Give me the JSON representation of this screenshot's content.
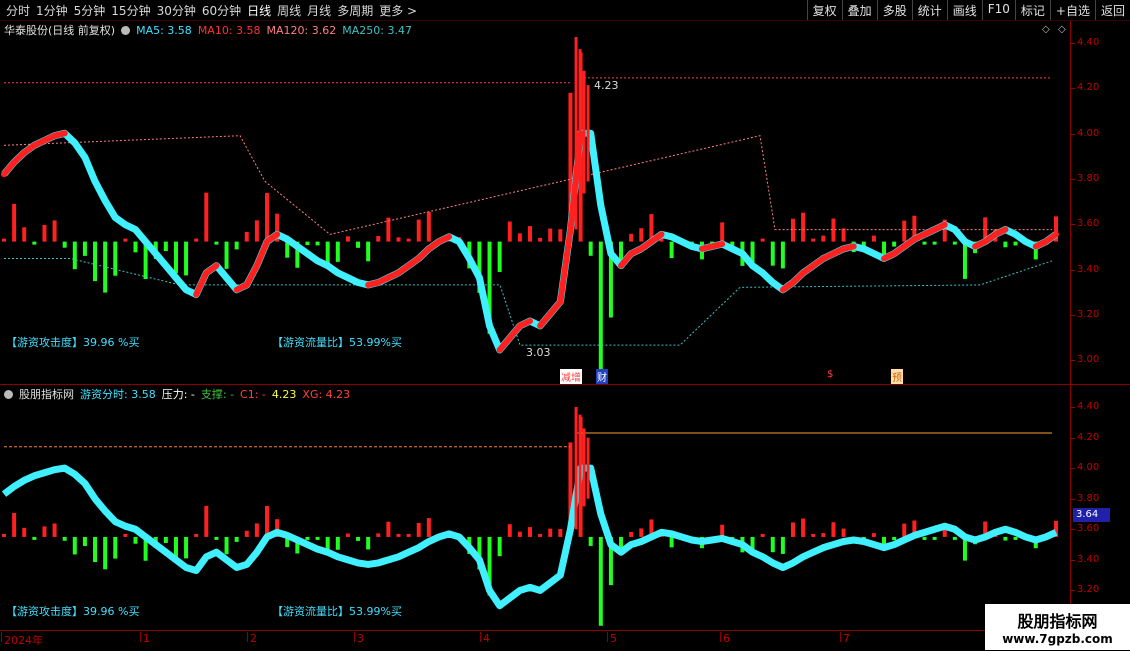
{
  "toolbar": {
    "periods": [
      "分时",
      "1分钟",
      "5分钟",
      "15分钟",
      "30分钟",
      "60分钟",
      "日线",
      "周线",
      "月线",
      "多周期",
      "更多 >"
    ],
    "active": "日线",
    "tools": [
      "复权",
      "叠加",
      "多股",
      "统计",
      "画线",
      "F10",
      "标记",
      "+自选",
      "返回"
    ]
  },
  "main": {
    "stock_title": "华泰股份(日线 前复权)",
    "ma": [
      {
        "label": "MA5: 3.58",
        "color": "#40e0ff"
      },
      {
        "label": "MA10: 3.58",
        "color": "#ff3030"
      },
      {
        "label": "MA120: 3.62",
        "color": "#ff8080"
      },
      {
        "label": "MA250: 3.47",
        "color": "#40c0c0"
      }
    ],
    "yticks": [
      "4.40",
      "4.20",
      "4.00",
      "3.80",
      "3.60",
      "3.40",
      "3.20",
      "3.00"
    ],
    "high_label": "4.23",
    "low_label": "3.03",
    "attack_label": "【游资攻击度】39.96 %买",
    "flow_label": "【游资流量比】53.99%买",
    "events": [
      {
        "text": "减增",
        "color": "#ff4040",
        "bg": "#ffffff"
      },
      {
        "text": "财",
        "color": "#ffffff",
        "bg": "#2040c0"
      },
      {
        "text": "$",
        "color": "#ff4040",
        "bg": "#000000"
      },
      {
        "text": "预",
        "color": "#d06020",
        "bg": "#ffe0a0"
      }
    ]
  },
  "sub": {
    "indicator_title": "股朋指标网",
    "items": [
      {
        "label": "游资分时: 3.58",
        "color": "#40e0ff"
      },
      {
        "label": "压力: -",
        "color": "#ffffff"
      },
      {
        "label": "支撑: -",
        "color": "#40c040"
      },
      {
        "label": "C1: -",
        "color": "#ff4040"
      },
      {
        "label": "4.23",
        "color": "#ffff40"
      },
      {
        "label": "XG: 4.23",
        "color": "#ff4040"
      }
    ],
    "yticks": [
      "4.40",
      "4.20",
      "4.00",
      "3.80",
      "3.60",
      "3.40",
      "3.20"
    ],
    "price_tag": "3.64",
    "attack_label": "【游资攻击度】39.96 %买",
    "flow_label": "【游资流量比】53.99%买"
  },
  "date_axis": [
    "2024年",
    "1",
    "2",
    "3",
    "4",
    "5",
    "6",
    "7"
  ],
  "watermark": {
    "line1": "股朋指标网",
    "line2": "www.7gpzb.com"
  },
  "chart_data": {
    "type": "line",
    "title": "华泰股份(日线 前复权)",
    "ylim": [
      3.0,
      4.4
    ],
    "series": [
      {
        "name": "MA5",
        "values": [
          3.83,
          3.88,
          3.92,
          3.95,
          3.97,
          3.99,
          4.0,
          3.96,
          3.9,
          3.8,
          3.72,
          3.65,
          3.62,
          3.6,
          3.55,
          3.5,
          3.45,
          3.4,
          3.35,
          3.33,
          3.42,
          3.45,
          3.4,
          3.35,
          3.37,
          3.45,
          3.55,
          3.58,
          3.56,
          3.53,
          3.5,
          3.47,
          3.45,
          3.42,
          3.4,
          3.38,
          3.37,
          3.38,
          3.4,
          3.42,
          3.45,
          3.48,
          3.52,
          3.55,
          3.57,
          3.55,
          3.48,
          3.4,
          3.2,
          3.1,
          3.15,
          3.2,
          3.22,
          3.2,
          3.25,
          3.3,
          3.6,
          4.0,
          4.0,
          3.7,
          3.5,
          3.45,
          3.5,
          3.52,
          3.55,
          3.58,
          3.57,
          3.55,
          3.53,
          3.52,
          3.53,
          3.54,
          3.52,
          3.5,
          3.45,
          3.42,
          3.38,
          3.35,
          3.38,
          3.42,
          3.45,
          3.48,
          3.5,
          3.52,
          3.53,
          3.52,
          3.5,
          3.48,
          3.5,
          3.53,
          3.56,
          3.58,
          3.6,
          3.62,
          3.6,
          3.55,
          3.53,
          3.55,
          3.58,
          3.6,
          3.58,
          3.55,
          3.53,
          3.55,
          3.58
        ]
      }
    ]
  }
}
